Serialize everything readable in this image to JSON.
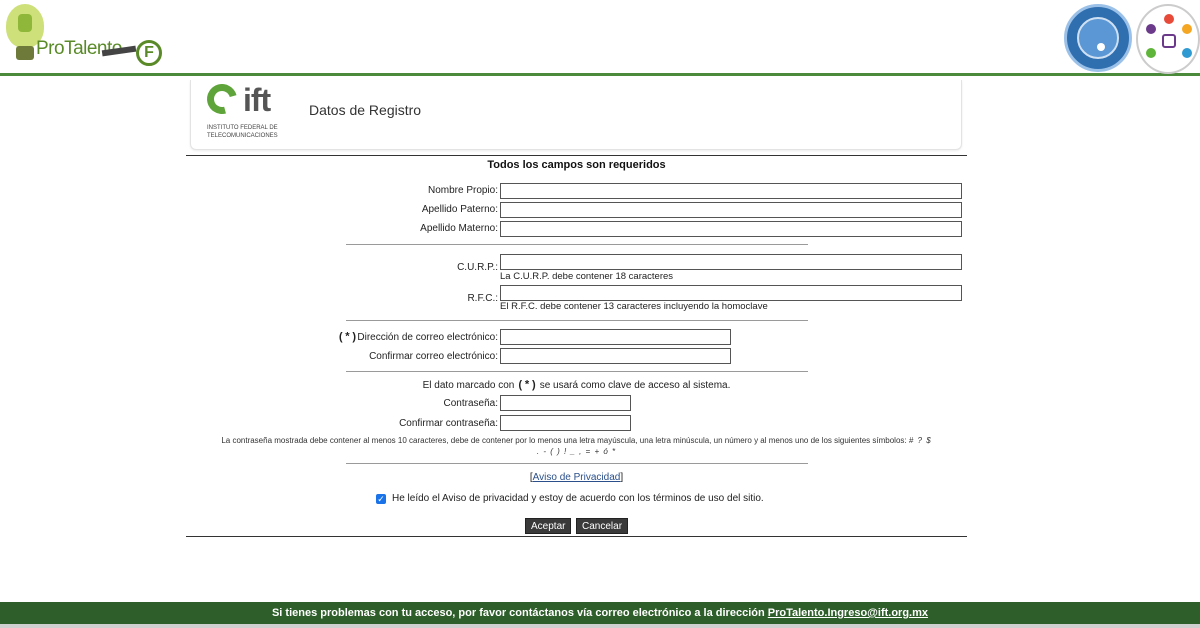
{
  "header": {
    "protalento_logo": "ProTalento",
    "icons": [
      "protalento-logo",
      "web-access-badge",
      "igualdad-laboral-badge"
    ]
  },
  "ift": {
    "logo_text": "ift",
    "logo_subtitle": "INSTITUTO FEDERAL DE TELECOMUNICACIONES",
    "page_title": "Datos de Registro"
  },
  "form": {
    "required_note": "Todos los campos son requeridos",
    "fields": {
      "nombre": {
        "label": "Nombre Propio:",
        "value": ""
      },
      "apellido_paterno": {
        "label": "Apellido Paterno:",
        "value": ""
      },
      "apellido_materno": {
        "label": "Apellido Materno:",
        "value": ""
      },
      "curp": {
        "label": "C.U.R.P.:",
        "value": "",
        "hint": "La C.U.R.P. debe contener 18 caracteres"
      },
      "rfc": {
        "label": "R.F.C.:",
        "value": "",
        "hint": "El R.F.C. debe contener 13 caracteres incluyendo la homoclave"
      },
      "email": {
        "label_prefix": "(*)",
        "label": "Dirección de correo electrónico:",
        "value": ""
      },
      "email_confirm": {
        "label": "Confirmar correo electrónico:",
        "value": ""
      },
      "password": {
        "label": "Contraseña:",
        "value": ""
      },
      "password_confirm": {
        "label": "Confirmar contraseña:",
        "value": ""
      }
    },
    "key_note_before": "El dato marcado con",
    "key_note_mark": "(*)",
    "key_note_after": "se usará como clave de acceso al sistema.",
    "password_rules": "La contraseña mostrada debe contener al menos 10 caracteres, debe de contener por lo menos una letra mayúscula, una letra minúscula, un número y al menos uno de los siguientes símbolos:",
    "password_symbols_1": "# ? $",
    "password_symbols_2": ". - ( ) ! _ , = + ó *",
    "privacy_open": "[",
    "privacy_link": "Aviso de Privacidad",
    "privacy_close": "]",
    "accept_terms_checked": true,
    "accept_terms_label": "He leído el Aviso de privacidad y estoy de acuerdo con los términos de uso del sitio.",
    "accept_button": "Aceptar",
    "cancel_button": "Cancelar"
  },
  "footer": {
    "text": "Si tienes problemas con tu acceso, por favor contáctanos vía correo electrónico a la dirección",
    "email": "ProTalento.Ingreso@ift.org.mx"
  },
  "colors": {
    "brand_green": "#2e5f2a",
    "header_rule": "#4a8a3a",
    "button_dark": "#3a3a3a"
  }
}
